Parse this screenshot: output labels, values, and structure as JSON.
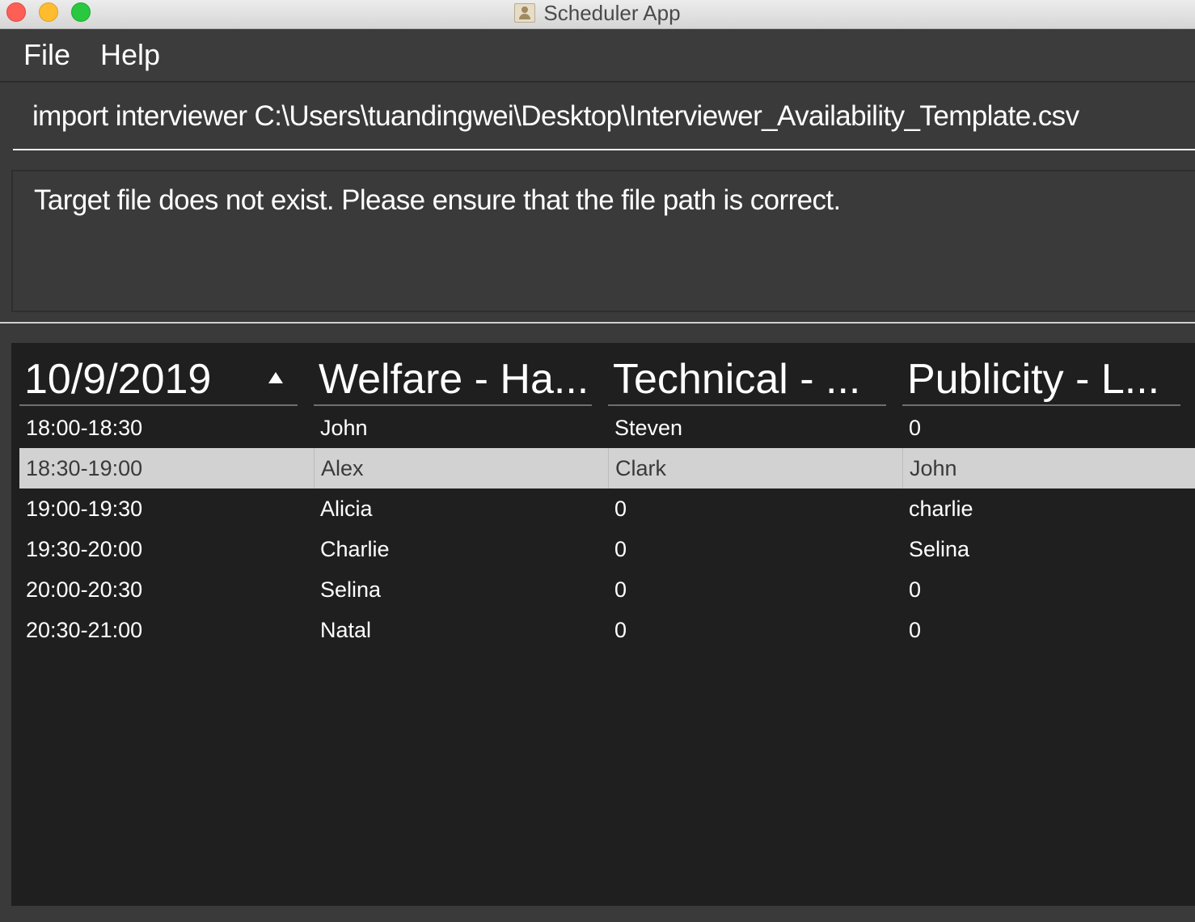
{
  "window": {
    "title": "Scheduler App",
    "icon": "contacts-book-icon"
  },
  "menu": {
    "file_label": "File",
    "help_label": "Help"
  },
  "command": {
    "value": "import interviewer C:\\Users\\tuandingwei\\Desktop\\Interviewer_Availability_Template.csv"
  },
  "result": {
    "message": "Target file does not exist. Please ensure that the file path is correct."
  },
  "schedule": {
    "headers": [
      "10/9/2019",
      "Welfare - Ha...",
      "Technical - ...",
      "Publicity - L..."
    ],
    "sort_indicator": "ascending",
    "selected_row_index": 1,
    "rows": [
      [
        "18:00-18:30",
        "John",
        "Steven",
        "0"
      ],
      [
        "18:30-19:00",
        "Alex",
        "Clark",
        "John"
      ],
      [
        "19:00-19:30",
        "Alicia",
        "0",
        "charlie"
      ],
      [
        "19:30-20:00",
        "Charlie",
        "0",
        "Selina"
      ],
      [
        "20:00-20:30",
        "Selina",
        "0",
        "0"
      ],
      [
        "20:30-21:00",
        "Natal",
        "0",
        "0"
      ]
    ]
  },
  "colors": {
    "table_background": "#1f1f1f",
    "panel_background": "#3a3a3a",
    "selected_row": "#d2d2d2",
    "text": "#ffffff"
  }
}
